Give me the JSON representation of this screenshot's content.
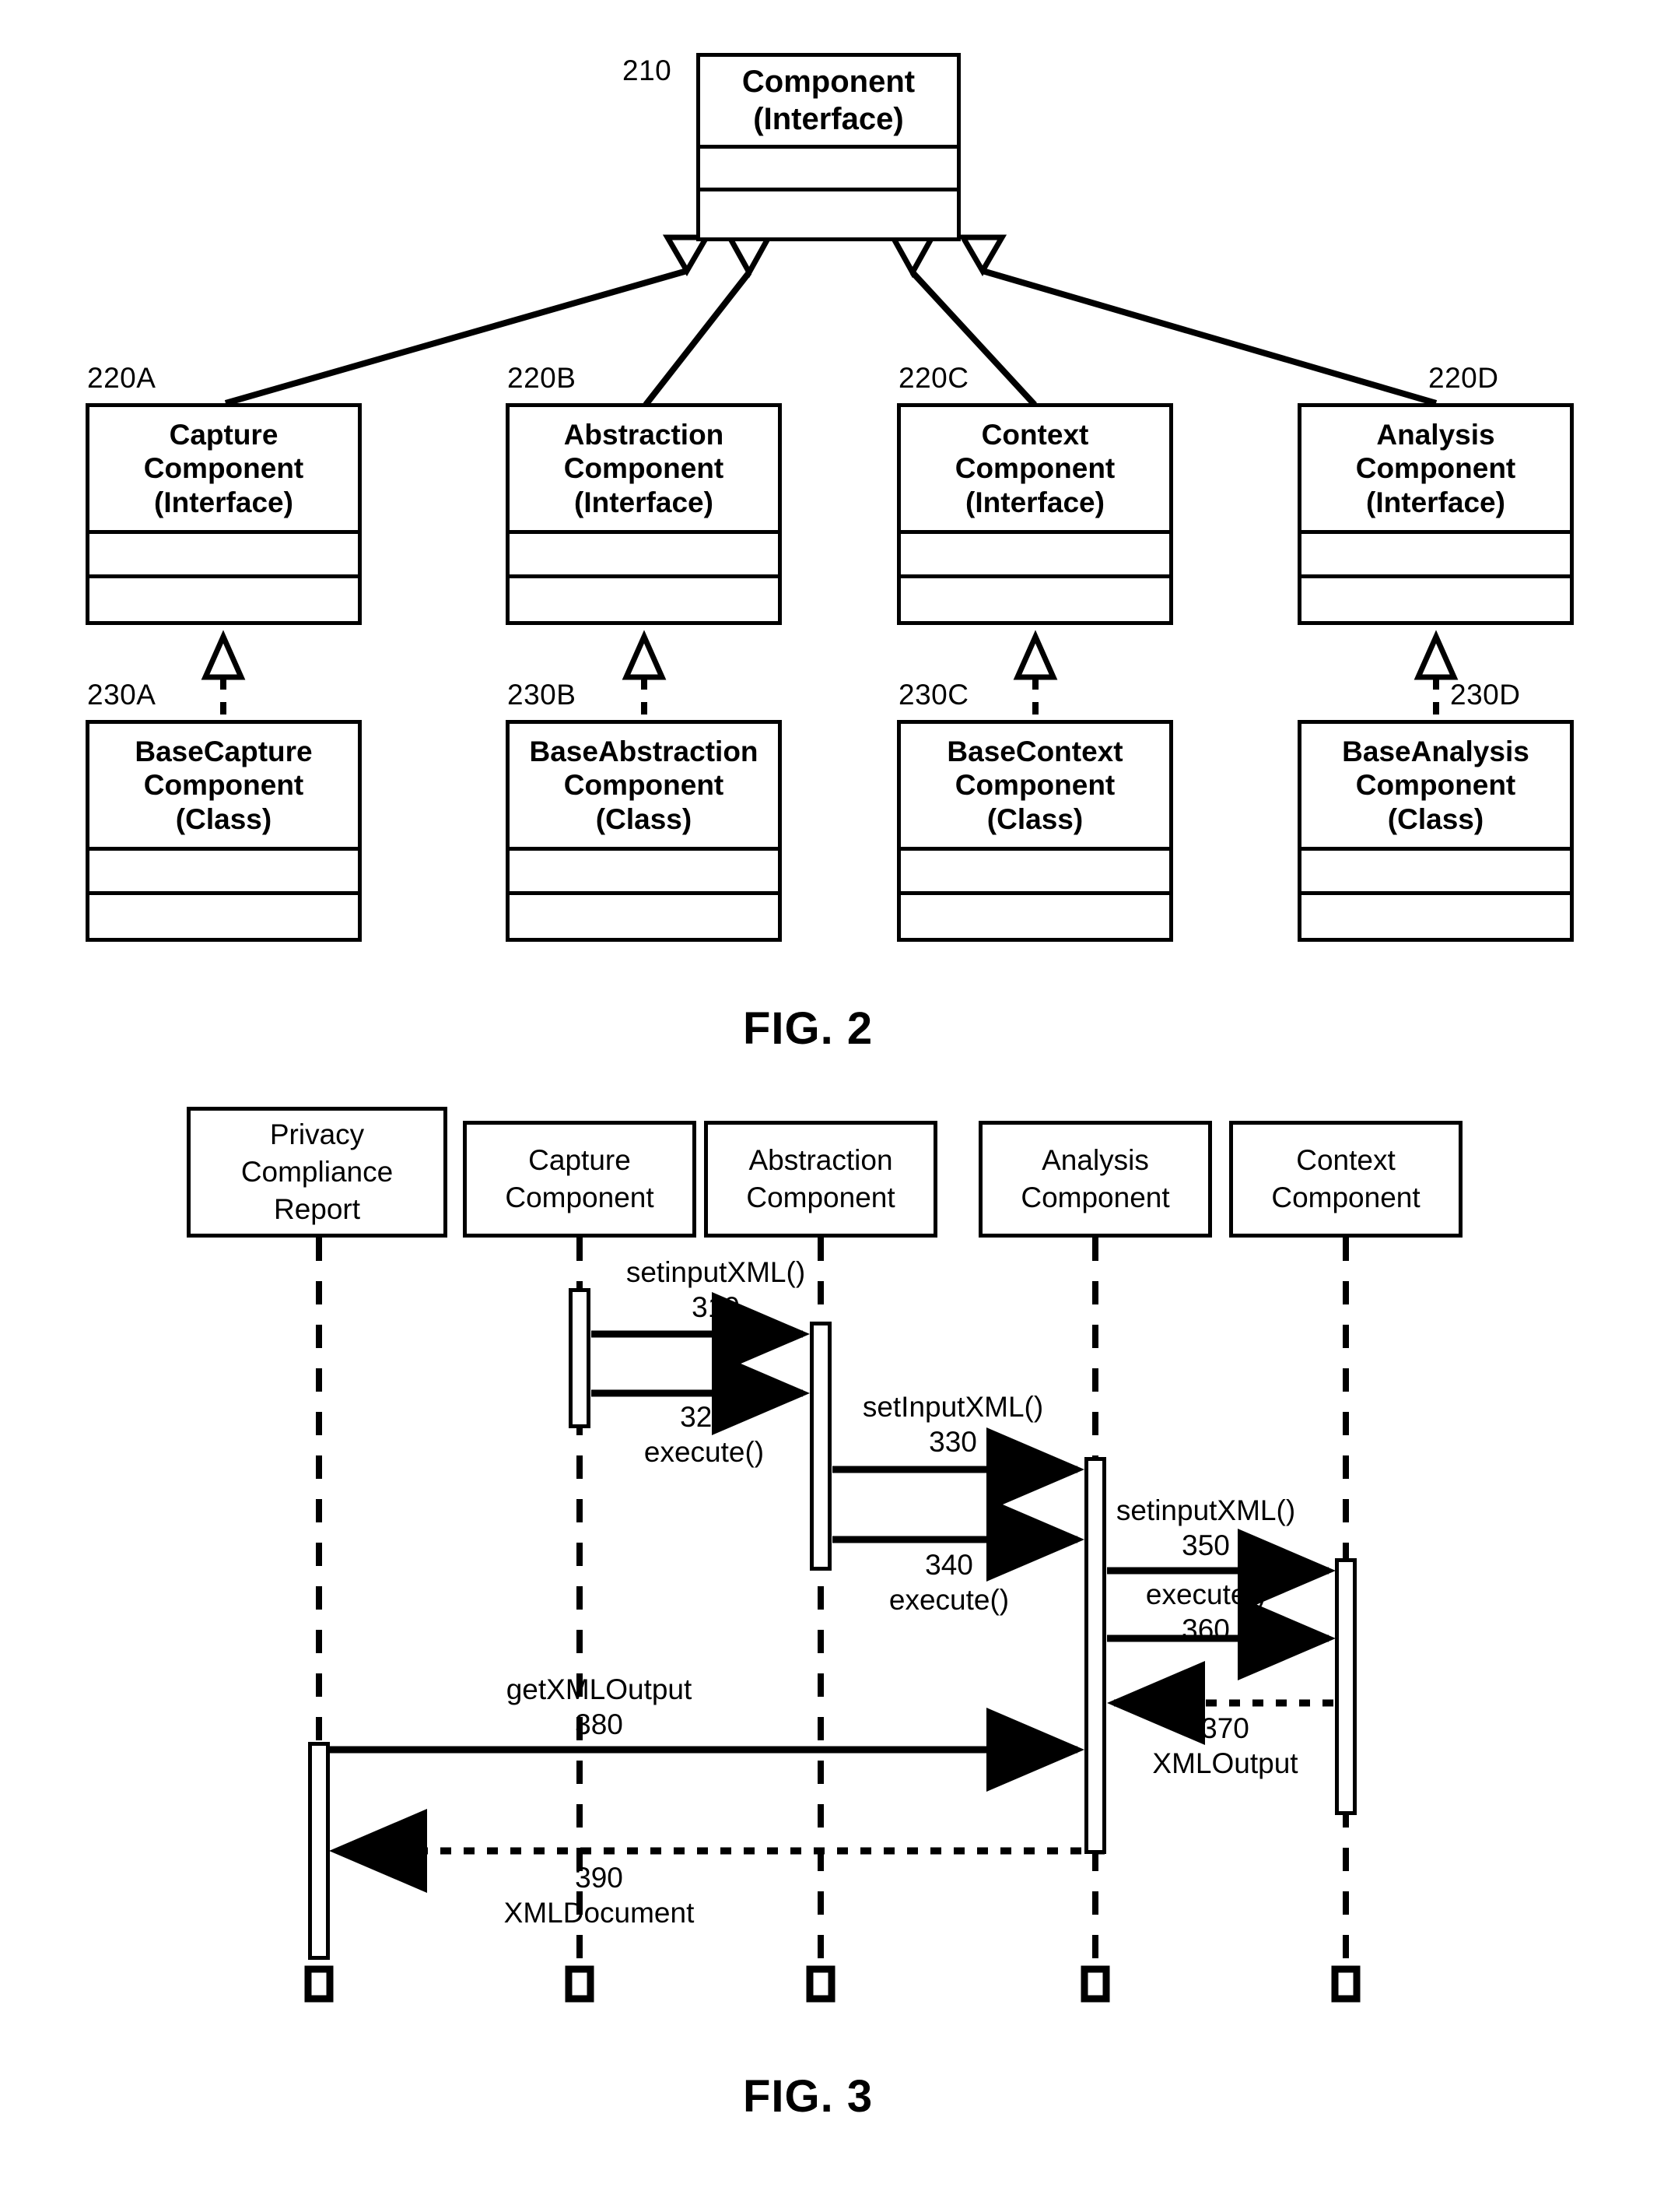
{
  "figures": [
    {
      "id": "fig2",
      "caption": "FIG. 2",
      "type": "uml-class-diagram",
      "root": {
        "ref": "210",
        "title_lines": [
          "Component",
          "(Interface)"
        ]
      },
      "interfaces": [
        {
          "ref": "220A",
          "title_lines": [
            "Capture",
            "Component",
            "(Interface)"
          ]
        },
        {
          "ref": "220B",
          "title_lines": [
            "Abstraction",
            "Component",
            "(Interface)"
          ]
        },
        {
          "ref": "220C",
          "title_lines": [
            "Context",
            "Component",
            "(Interface)"
          ]
        },
        {
          "ref": "220D",
          "title_lines": [
            "Analysis",
            "Component",
            "(Interface)"
          ]
        }
      ],
      "classes": [
        {
          "ref": "230A",
          "title_lines": [
            "BaseCapture",
            "Component",
            "(Class)"
          ]
        },
        {
          "ref": "230B",
          "title_lines": [
            "BaseAbstraction",
            "Component",
            "(Class)"
          ]
        },
        {
          "ref": "230C",
          "title_lines": [
            "BaseContext",
            "Component",
            "(Class)"
          ]
        },
        {
          "ref": "230D",
          "title_lines": [
            "BaseAnalysis",
            "Component",
            "(Class)"
          ]
        }
      ]
    },
    {
      "id": "fig3",
      "caption": "FIG. 3",
      "type": "uml-sequence-diagram",
      "lifelines": [
        {
          "title_lines": [
            "Privacy",
            "Compliance",
            "Report"
          ]
        },
        {
          "title_lines": [
            "Capture",
            "Component"
          ]
        },
        {
          "title_lines": [
            "Abstraction",
            "Component"
          ]
        },
        {
          "title_lines": [
            "Analysis",
            "Component"
          ]
        },
        {
          "title_lines": [
            "Context",
            "Component"
          ]
        }
      ],
      "messages": [
        {
          "ref": "310",
          "name": "setinputXML()",
          "from": "Capture Component",
          "to": "Abstraction Component",
          "style": "solid"
        },
        {
          "ref": "320",
          "name": "execute()",
          "from": "Capture Component",
          "to": "Abstraction Component",
          "style": "solid"
        },
        {
          "ref": "330",
          "name": "setInputXML()",
          "from": "Abstraction Component",
          "to": "Analysis Component",
          "style": "solid"
        },
        {
          "ref": "340",
          "name": "execute()",
          "from": "Abstraction Component",
          "to": "Analysis Component",
          "style": "solid"
        },
        {
          "ref": "350",
          "name": "setinputXML()",
          "from": "Analysis Component",
          "to": "Context Component",
          "style": "solid"
        },
        {
          "ref": "360",
          "name": "execute()",
          "from": "Analysis Component",
          "to": "Context Component",
          "style": "solid"
        },
        {
          "ref": "370",
          "name": "XMLOutput",
          "from": "Context Component",
          "to": "Analysis Component",
          "style": "dashed"
        },
        {
          "ref": "380",
          "name": "getXMLOutput",
          "from": "Privacy Compliance Report",
          "to": "Analysis Component",
          "style": "solid"
        },
        {
          "ref": "390",
          "name": "XMLDocument",
          "from": "Analysis Component",
          "to": "Privacy Compliance Report",
          "style": "dashed"
        }
      ],
      "labels": {
        "l310": {
          "line1": "setinputXML()",
          "line2": "310"
        },
        "l320": {
          "line1": "320",
          "line2": "execute()"
        },
        "l330": {
          "line1": "setInputXML()",
          "line2": "330"
        },
        "l340": {
          "line1": "340",
          "line2": "execute()"
        },
        "l350": {
          "line1": "setinputXML()",
          "line2": "350"
        },
        "l360": {
          "line1": "execute()",
          "line2": "360"
        },
        "l370": {
          "line1": "370",
          "line2": "XMLOutput"
        },
        "l380": {
          "line1": "getXMLOutput",
          "line2": "380"
        },
        "l390": {
          "line1": "390",
          "line2": "XMLDocument"
        }
      }
    }
  ],
  "colors": {
    "stroke": "#000000",
    "fill": "#ffffff"
  }
}
